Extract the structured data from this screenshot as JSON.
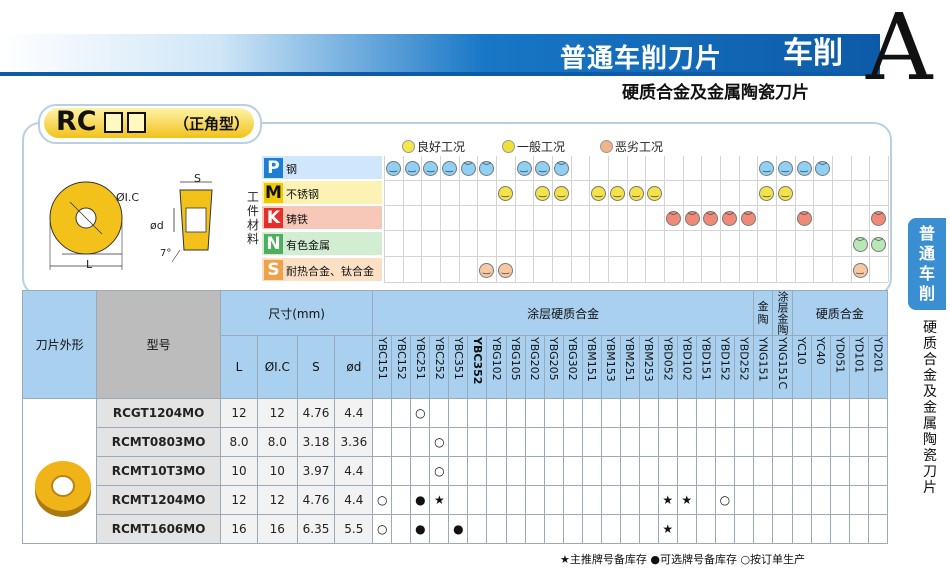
{
  "header": {
    "title": "普通车削刀片",
    "tag": "车削",
    "letter": "A",
    "subtitle": "硬质合金及金属陶瓷刀片"
  },
  "side": {
    "tab_lines": [
      "普",
      "通",
      "车",
      "削"
    ],
    "text_lines": [
      "硬",
      "质",
      "合",
      "金",
      "及",
      "金",
      "属",
      "陶",
      "瓷",
      "刀",
      "片"
    ]
  },
  "model": {
    "code": "RC",
    "name": "（正角型）"
  },
  "diagram": {
    "dim_ic": "ØI.C",
    "dim_s": "S",
    "dim_d": "ød",
    "dim_l": "L",
    "angle": "7°"
  },
  "legend": [
    {
      "face": "good",
      "text": "良好工况",
      "color": "#f7e64a"
    },
    {
      "face": "normal",
      "text": "一般工况",
      "color": "#f2e03a"
    },
    {
      "face": "bad",
      "text": "恶劣工况",
      "color": "#f2b38a"
    }
  ],
  "materials": {
    "vertical_label": [
      "工",
      "件",
      "材",
      "料"
    ],
    "rows": [
      {
        "letter": "P",
        "name": "钢",
        "color": "#1d7fd2",
        "bg": "#cfe6fb"
      },
      {
        "letter": "M",
        "name": "不锈钢",
        "color": "#f2c800",
        "bg": "#fbf2b3"
      },
      {
        "letter": "K",
        "name": "铸铁",
        "color": "#e2312a",
        "bg": "#f7c7b7"
      },
      {
        "letter": "N",
        "name": "有色金属",
        "color": "#4ab05a",
        "bg": "#d2eed2"
      },
      {
        "letter": "S",
        "name": "耐热合金、钛合金",
        "color": "#f0a24a",
        "bg": "#fbe0c4"
      }
    ]
  },
  "grades": [
    "YBC151",
    "YBC152",
    "YBC251",
    "YBC252",
    "YBC351",
    "YBC352",
    "YBG102",
    "YBG105",
    "YBG202",
    "YBG205",
    "YBG302",
    "YBM151",
    "YBM153",
    "YBM251",
    "YBM253",
    "YBD052",
    "YBD102",
    "YBD151",
    "YBD152",
    "YBD252",
    "YNG151",
    "YNG151C",
    "YC10",
    "YC40",
    "YD051",
    "YD101",
    "YD201"
  ],
  "applicability": [
    [
      "b",
      "b",
      "b",
      "b",
      "p",
      "p",
      "",
      "b",
      "b",
      "p",
      "",
      "",
      "",
      "",
      "",
      "",
      "",
      "",
      "",
      "",
      "b",
      "b",
      "b",
      "p",
      "",
      "",
      ""
    ],
    [
      "",
      "",
      "",
      "",
      "",
      "",
      "y",
      "",
      "y",
      "y",
      "",
      "y",
      "y",
      "y",
      "y",
      "",
      "",
      "",
      "",
      "",
      "y",
      "y",
      "",
      "",
      "",
      "",
      ""
    ],
    [
      "",
      "",
      "",
      "",
      "",
      "",
      "",
      "",
      "",
      "",
      "",
      "",
      "",
      "",
      "",
      "r",
      "r",
      "r",
      "r",
      "r",
      "",
      "",
      "r",
      "",
      "",
      "",
      "r"
    ],
    [
      "",
      "",
      "",
      "",
      "",
      "",
      "",
      "",
      "",
      "",
      "",
      "",
      "",
      "",
      "",
      "",
      "",
      "",
      "",
      "",
      "",
      "",
      "",
      "",
      "",
      "g",
      "g"
    ],
    [
      "",
      "",
      "",
      "",
      "",
      "o",
      "o",
      "",
      "",
      "",
      "",
      "",
      "",
      "",
      "",
      "",
      "",
      "",
      "",
      "",
      "",
      "",
      "",
      "",
      "",
      "o",
      ""
    ]
  ],
  "table": {
    "h_shape": "刀片外形",
    "h_model": "型号",
    "h_dims": "尺寸(mm)",
    "h_coated": "涂层硬质合金",
    "h_cermet": "金属陶瓷",
    "h_carbide": "硬质合金",
    "h_cermet_short": "金陶",
    "h_coated_cermet": "涂层金陶",
    "dim_cols": [
      "L",
      "ØI.C",
      "S",
      "ød"
    ],
    "rows": [
      {
        "model": "RCGT1204MO",
        "L": "12",
        "IC": "12",
        "S": "4.76",
        "d": "4.4",
        "marks": {
          "2": "○"
        }
      },
      {
        "model": "RCMT0803MO",
        "L": "8.0",
        "IC": "8.0",
        "S": "3.18",
        "d": "3.36",
        "marks": {
          "3": "○"
        }
      },
      {
        "model": "RCMT10T3MO",
        "L": "10",
        "IC": "10",
        "S": "3.97",
        "d": "4.4",
        "marks": {
          "3": "○"
        }
      },
      {
        "model": "RCMT1204MO",
        "L": "12",
        "IC": "12",
        "S": "4.76",
        "d": "4.4",
        "marks": {
          "0": "○",
          "2": "●",
          "3": "★",
          "15": "★",
          "16": "★",
          "18": "○"
        }
      },
      {
        "model": "RCMT1606MO",
        "L": "16",
        "IC": "16",
        "S": "6.35",
        "d": "5.5",
        "marks": {
          "0": "○",
          "2": "●",
          "4": "●",
          "15": "★"
        }
      }
    ]
  },
  "footnote": "★主推牌号备库存  ●可选牌号备库存  ○按订单生产",
  "colors": {
    "accent": "#0d5ba8",
    "insert": "#f2c21b"
  }
}
